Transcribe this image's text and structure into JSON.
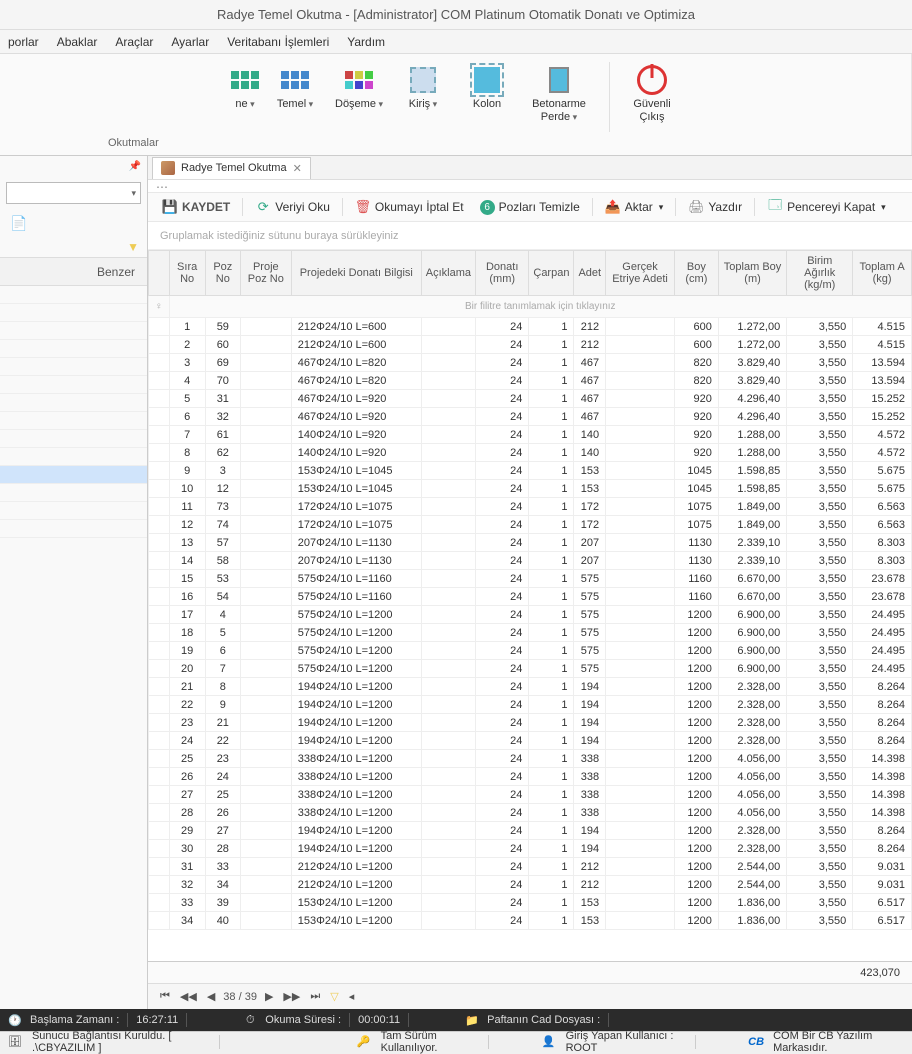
{
  "title": "Radye Temel Okutma - [Administrator] COM Platinum Otomatik Donatı ve Optimiza",
  "menu": [
    "porlar",
    "Abaklar",
    "Araçlar",
    "Ayarlar",
    "Veritabanı İşlemleri",
    "Yardım"
  ],
  "ribbon": {
    "group_caption": "Okutmalar",
    "items": [
      {
        "label": "ne",
        "has_caret": true
      },
      {
        "label": "Temel",
        "has_caret": true
      },
      {
        "label": "Döşeme",
        "has_caret": true
      },
      {
        "label": "Kiriş",
        "has_caret": true
      },
      {
        "label": "Kolon"
      },
      {
        "label": "Betonarme Perde",
        "has_caret": true
      },
      {
        "label": "Güvenli Çıkış"
      }
    ]
  },
  "side": {
    "header": "Benzer"
  },
  "tab": {
    "label": "Radye Temel Okutma"
  },
  "toolbar": {
    "kaydet": "KAYDET",
    "veriyi_oku": "Veriyi Oku",
    "iptal": "Okumayı İptal Et",
    "temizle": "Pozları Temizle",
    "aktar": "Aktar",
    "yazdir": "Yazdır",
    "kapat": "Pencereyi Kapat"
  },
  "group_hint": "Gruplamak istediğiniz sütunu buraya sürükleyiniz",
  "columns": [
    "Sıra No",
    "Poz No",
    "Proje Poz No",
    "Projedeki Donatı Bilgisi",
    "Açıklama",
    "Donatı (mm)",
    "Çarpan",
    "Adet",
    "Gerçek Etriye Adeti",
    "Boy (cm)",
    "Toplam Boy (m)",
    "Birim Ağırlık (kg/m)",
    "Toplam A (kg)"
  ],
  "filter_row_text": "Bir filitre tanımlamak için tıklayınız",
  "rows": [
    {
      "sira": 1,
      "poz": 59,
      "bilgi": "212Φ24/10 L=600",
      "donati": 24,
      "carpan": 1,
      "adet": 212,
      "boy": 600,
      "toplam": "1.272,00",
      "birim": "3,550",
      "agirlik": "4.515"
    },
    {
      "sira": 2,
      "poz": 60,
      "bilgi": "212Φ24/10 L=600",
      "donati": 24,
      "carpan": 1,
      "adet": 212,
      "boy": 600,
      "toplam": "1.272,00",
      "birim": "3,550",
      "agirlik": "4.515"
    },
    {
      "sira": 3,
      "poz": 69,
      "bilgi": "467Φ24/10 L=820",
      "donati": 24,
      "carpan": 1,
      "adet": 467,
      "boy": 820,
      "toplam": "3.829,40",
      "birim": "3,550",
      "agirlik": "13.594"
    },
    {
      "sira": 4,
      "poz": 70,
      "bilgi": "467Φ24/10 L=820",
      "donati": 24,
      "carpan": 1,
      "adet": 467,
      "boy": 820,
      "toplam": "3.829,40",
      "birim": "3,550",
      "agirlik": "13.594"
    },
    {
      "sira": 5,
      "poz": 31,
      "bilgi": "467Φ24/10 L=920",
      "donati": 24,
      "carpan": 1,
      "adet": 467,
      "boy": 920,
      "toplam": "4.296,40",
      "birim": "3,550",
      "agirlik": "15.252"
    },
    {
      "sira": 6,
      "poz": 32,
      "bilgi": "467Φ24/10 L=920",
      "donati": 24,
      "carpan": 1,
      "adet": 467,
      "boy": 920,
      "toplam": "4.296,40",
      "birim": "3,550",
      "agirlik": "15.252"
    },
    {
      "sira": 7,
      "poz": 61,
      "bilgi": "140Φ24/10 L=920",
      "donati": 24,
      "carpan": 1,
      "adet": 140,
      "boy": 920,
      "toplam": "1.288,00",
      "birim": "3,550",
      "agirlik": "4.572"
    },
    {
      "sira": 8,
      "poz": 62,
      "bilgi": "140Φ24/10 L=920",
      "donati": 24,
      "carpan": 1,
      "adet": 140,
      "boy": 920,
      "toplam": "1.288,00",
      "birim": "3,550",
      "agirlik": "4.572"
    },
    {
      "sira": 9,
      "poz": 3,
      "bilgi": "153Φ24/10 L=1045",
      "donati": 24,
      "carpan": 1,
      "adet": 153,
      "boy": 1045,
      "toplam": "1.598,85",
      "birim": "3,550",
      "agirlik": "5.675"
    },
    {
      "sira": 10,
      "poz": 12,
      "bilgi": "153Φ24/10 L=1045",
      "donati": 24,
      "carpan": 1,
      "adet": 153,
      "boy": 1045,
      "toplam": "1.598,85",
      "birim": "3,550",
      "agirlik": "5.675"
    },
    {
      "sira": 11,
      "poz": 73,
      "bilgi": "172Φ24/10 L=1075",
      "donati": 24,
      "carpan": 1,
      "adet": 172,
      "boy": 1075,
      "toplam": "1.849,00",
      "birim": "3,550",
      "agirlik": "6.563"
    },
    {
      "sira": 12,
      "poz": 74,
      "bilgi": "172Φ24/10 L=1075",
      "donati": 24,
      "carpan": 1,
      "adet": 172,
      "boy": 1075,
      "toplam": "1.849,00",
      "birim": "3,550",
      "agirlik": "6.563"
    },
    {
      "sira": 13,
      "poz": 57,
      "bilgi": "207Φ24/10 L=1130",
      "donati": 24,
      "carpan": 1,
      "adet": 207,
      "boy": 1130,
      "toplam": "2.339,10",
      "birim": "3,550",
      "agirlik": "8.303"
    },
    {
      "sira": 14,
      "poz": 58,
      "bilgi": "207Φ24/10 L=1130",
      "donati": 24,
      "carpan": 1,
      "adet": 207,
      "boy": 1130,
      "toplam": "2.339,10",
      "birim": "3,550",
      "agirlik": "8.303"
    },
    {
      "sira": 15,
      "poz": 53,
      "bilgi": "575Φ24/10 L=1160",
      "donati": 24,
      "carpan": 1,
      "adet": 575,
      "boy": 1160,
      "toplam": "6.670,00",
      "birim": "3,550",
      "agirlik": "23.678"
    },
    {
      "sira": 16,
      "poz": 54,
      "bilgi": "575Φ24/10 L=1160",
      "donati": 24,
      "carpan": 1,
      "adet": 575,
      "boy": 1160,
      "toplam": "6.670,00",
      "birim": "3,550",
      "agirlik": "23.678"
    },
    {
      "sira": 17,
      "poz": 4,
      "bilgi": "575Φ24/10 L=1200",
      "donati": 24,
      "carpan": 1,
      "adet": 575,
      "boy": 1200,
      "toplam": "6.900,00",
      "birim": "3,550",
      "agirlik": "24.495"
    },
    {
      "sira": 18,
      "poz": 5,
      "bilgi": "575Φ24/10 L=1200",
      "donati": 24,
      "carpan": 1,
      "adet": 575,
      "boy": 1200,
      "toplam": "6.900,00",
      "birim": "3,550",
      "agirlik": "24.495"
    },
    {
      "sira": 19,
      "poz": 6,
      "bilgi": "575Φ24/10 L=1200",
      "donati": 24,
      "carpan": 1,
      "adet": 575,
      "boy": 1200,
      "toplam": "6.900,00",
      "birim": "3,550",
      "agirlik": "24.495"
    },
    {
      "sira": 20,
      "poz": 7,
      "bilgi": "575Φ24/10 L=1200",
      "donati": 24,
      "carpan": 1,
      "adet": 575,
      "boy": 1200,
      "toplam": "6.900,00",
      "birim": "3,550",
      "agirlik": "24.495"
    },
    {
      "sira": 21,
      "poz": 8,
      "bilgi": "194Φ24/10 L=1200",
      "donati": 24,
      "carpan": 1,
      "adet": 194,
      "boy": 1200,
      "toplam": "2.328,00",
      "birim": "3,550",
      "agirlik": "8.264"
    },
    {
      "sira": 22,
      "poz": 9,
      "bilgi": "194Φ24/10 L=1200",
      "donati": 24,
      "carpan": 1,
      "adet": 194,
      "boy": 1200,
      "toplam": "2.328,00",
      "birim": "3,550",
      "agirlik": "8.264"
    },
    {
      "sira": 23,
      "poz": 21,
      "bilgi": "194Φ24/10 L=1200",
      "donati": 24,
      "carpan": 1,
      "adet": 194,
      "boy": 1200,
      "toplam": "2.328,00",
      "birim": "3,550",
      "agirlik": "8.264"
    },
    {
      "sira": 24,
      "poz": 22,
      "bilgi": "194Φ24/10 L=1200",
      "donati": 24,
      "carpan": 1,
      "adet": 194,
      "boy": 1200,
      "toplam": "2.328,00",
      "birim": "3,550",
      "agirlik": "8.264"
    },
    {
      "sira": 25,
      "poz": 23,
      "bilgi": "338Φ24/10 L=1200",
      "donati": 24,
      "carpan": 1,
      "adet": 338,
      "boy": 1200,
      "toplam": "4.056,00",
      "birim": "3,550",
      "agirlik": "14.398"
    },
    {
      "sira": 26,
      "poz": 24,
      "bilgi": "338Φ24/10 L=1200",
      "donati": 24,
      "carpan": 1,
      "adet": 338,
      "boy": 1200,
      "toplam": "4.056,00",
      "birim": "3,550",
      "agirlik": "14.398"
    },
    {
      "sira": 27,
      "poz": 25,
      "bilgi": "338Φ24/10 L=1200",
      "donati": 24,
      "carpan": 1,
      "adet": 338,
      "boy": 1200,
      "toplam": "4.056,00",
      "birim": "3,550",
      "agirlik": "14.398"
    },
    {
      "sira": 28,
      "poz": 26,
      "bilgi": "338Φ24/10 L=1200",
      "donati": 24,
      "carpan": 1,
      "adet": 338,
      "boy": 1200,
      "toplam": "4.056,00",
      "birim": "3,550",
      "agirlik": "14.398"
    },
    {
      "sira": 29,
      "poz": 27,
      "bilgi": "194Φ24/10 L=1200",
      "donati": 24,
      "carpan": 1,
      "adet": 194,
      "boy": 1200,
      "toplam": "2.328,00",
      "birim": "3,550",
      "agirlik": "8.264"
    },
    {
      "sira": 30,
      "poz": 28,
      "bilgi": "194Φ24/10 L=1200",
      "donati": 24,
      "carpan": 1,
      "adet": 194,
      "boy": 1200,
      "toplam": "2.328,00",
      "birim": "3,550",
      "agirlik": "8.264"
    },
    {
      "sira": 31,
      "poz": 33,
      "bilgi": "212Φ24/10 L=1200",
      "donati": 24,
      "carpan": 1,
      "adet": 212,
      "boy": 1200,
      "toplam": "2.544,00",
      "birim": "3,550",
      "agirlik": "9.031"
    },
    {
      "sira": 32,
      "poz": 34,
      "bilgi": "212Φ24/10 L=1200",
      "donati": 24,
      "carpan": 1,
      "adet": 212,
      "boy": 1200,
      "toplam": "2.544,00",
      "birim": "3,550",
      "agirlik": "9.031"
    },
    {
      "sira": 33,
      "poz": 39,
      "bilgi": "153Φ24/10 L=1200",
      "donati": 24,
      "carpan": 1,
      "adet": 153,
      "boy": 1200,
      "toplam": "1.836,00",
      "birim": "3,550",
      "agirlik": "6.517"
    },
    {
      "sira": 34,
      "poz": 40,
      "bilgi": "153Φ24/10 L=1200",
      "donati": 24,
      "carpan": 1,
      "adet": 153,
      "boy": 1200,
      "toplam": "1.836,00",
      "birim": "3,550",
      "agirlik": "6.517"
    }
  ],
  "sum_total": "423,070",
  "paginator": {
    "page_text": "38 / 39"
  },
  "status1": {
    "baslama_label": "Başlama Zamanı :",
    "baslama_val": "16:27:11",
    "okuma_label": "Okuma Süresi :",
    "okuma_val": "00:00:11",
    "pafta_label": "Paftanın Cad Dosyası :"
  },
  "status2": {
    "sunucu": "Sunucu Bağlantısı Kuruldu. [ .\\CBYAZILIM ]",
    "tam": "Tam Sürüm Kullanılıyor.",
    "giris": "Giriş Yapan Kullanıcı : ROOT",
    "marka": "COM Bir CB Yazılım Markasıdır."
  }
}
